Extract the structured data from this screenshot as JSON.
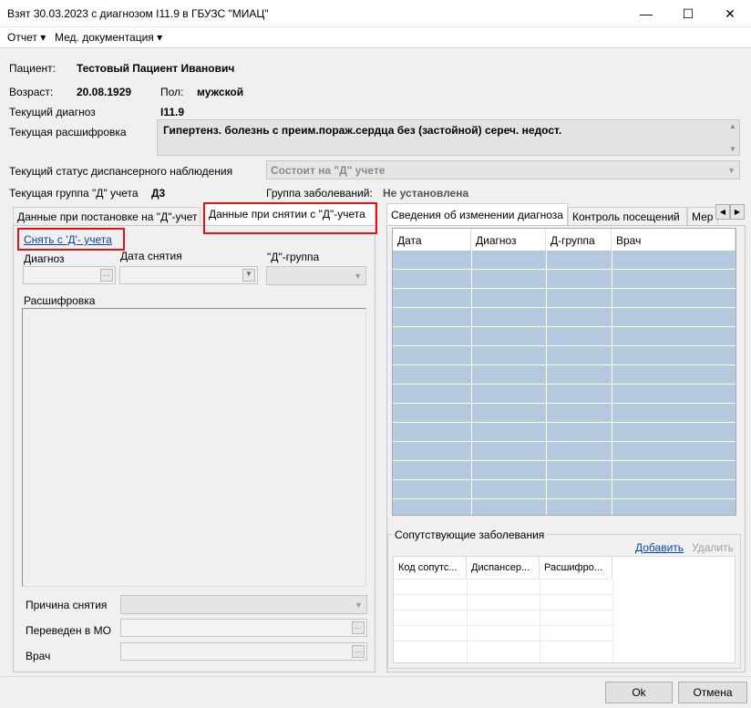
{
  "window": {
    "title": "Взят 30.03.2023 с диагнозом I11.9 в ГБУЗС \"МИАЦ\"",
    "minimize": "—",
    "maximize": "☐",
    "close": "✕"
  },
  "menu": {
    "report": "Отчет ▾",
    "med_docs": "Мед. документация ▾"
  },
  "patient": {
    "patient_label": "Пациент:",
    "patient_name": "Тестовый Пациент Иванович",
    "age_label": "Возраст:",
    "birth_date": "20.08.1929",
    "sex_label": "Пол:",
    "sex": "мужской",
    "diag_label": "Текущий диагноз",
    "diag": "I11.9",
    "decode_label": "Текущая расшифровка",
    "decode": "Гипертенз. болезнь с преим.пораж.сердца без (застойной) сереч. недост.",
    "status_label": "Текущий статус диспансерного наблюдения",
    "status": "Состоит на \"Д\" учете",
    "group_label": "Текущая группа \"Д\" учета",
    "group": "Д3",
    "disease_group_label": "Группа заболеваний:",
    "disease_group": "Не установлена"
  },
  "left_tabs": [
    "Данные при постановке на \"Д\"-учет",
    "Данные при снятии с \"Д\"-учета"
  ],
  "left_panel": {
    "remove_link": "Снять с 'Д'- учета",
    "diag_label": "Диагноз",
    "date_label": "Дата снятия",
    "dgroup_label": "\"Д\"-группа",
    "decode_label": "Расшифровка",
    "reason_label": "Причина снятия",
    "transfer_label": "Переведен в МО",
    "doctor_label": "Врач"
  },
  "right_tabs": [
    "Сведения об изменении диагноза",
    "Контроль посещений",
    "Мер"
  ],
  "history_grid": {
    "columns": [
      "Дата",
      "Диагноз",
      "Д-группа",
      "Врач"
    ]
  },
  "comorbid": {
    "title": "Сопутствующие заболевания",
    "add": "Добавить",
    "delete": "Удалить",
    "columns": [
      "Код сопутс...",
      "Диспансер...",
      "Расшифро..."
    ]
  },
  "buttons": {
    "ok": "Ok",
    "cancel": "Отмена"
  },
  "colors": {
    "highlight": "#e81010",
    "grid_row": "#b4c8de",
    "link": "#0645ad"
  }
}
